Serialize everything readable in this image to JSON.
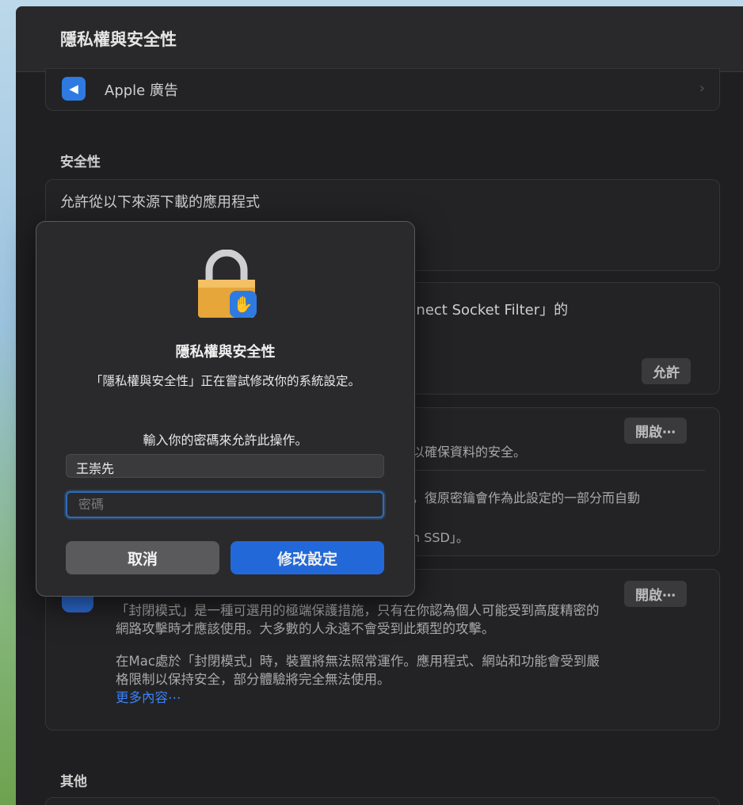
{
  "window": {
    "title": "隱私權與安全性"
  },
  "apple_ads": {
    "label": "Apple 廣告"
  },
  "security": {
    "section_title": "安全性",
    "allow_downloads_title": "允許從以下來源下載的應用程式",
    "socket_filter_fragment": "nnect Socket Filter」的",
    "allow_button": "允許",
    "filevault_button": "開啟⋯",
    "filevault_fragment1": "以確保資料的安全。",
    "filevault_fragment2": "，復原密鑰會作為此設定的一部分而自動",
    "filevault_fragment3": "n SSD」。",
    "lockdown_button": "開啟⋯",
    "lockdown_para1": "「封閉模式」是一種可選用的極端保護措施，只有在你認為個人可能受到高度精密的網路攻擊時才應該使用。大多數的人永遠不會受到此類型的攻擊。",
    "lockdown_para2": "在Mac處於「封閉模式」時，裝置將無法照常運作。應用程式、網站和功能會受到嚴格限制以保持安全，部分體驗將完全無法使用。",
    "lockdown_link": "更多內容⋯"
  },
  "other": {
    "section_title": "其他"
  },
  "dialog": {
    "title": "隱私權與安全性",
    "message": "「隱私權與安全性」正在嘗試修改你的系統設定。",
    "prompt": "輸入你的密碼來允許此操作。",
    "username_value": "王崇先",
    "password_placeholder": "密碼",
    "cancel_label": "取消",
    "ok_label": "修改設定"
  },
  "colors": {
    "accent": "#2268d8",
    "window_bg": "#1f1f21",
    "dialog_bg": "#2a2a2c"
  }
}
